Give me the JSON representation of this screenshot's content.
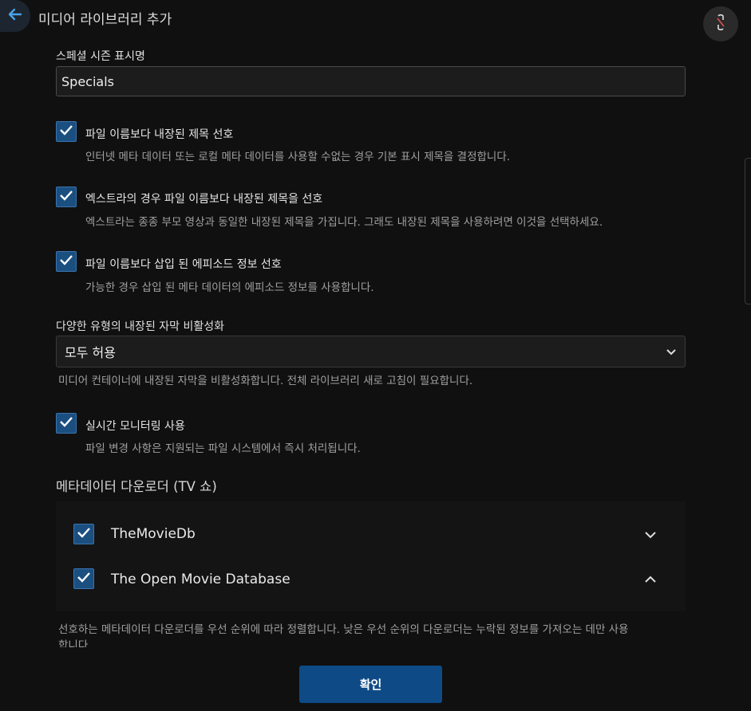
{
  "header": {
    "title": "미디어 라이브러리 추가"
  },
  "special_season": {
    "label": "스페셜 시즌 표시명",
    "value": "Specials"
  },
  "options": [
    {
      "label": "파일 이름보다 내장된 제목 선호",
      "description": "인터넷 메타 데이터 또는 로컬 메타 데이터를 사용할 수없는 경우 기본 표시 제목을 결정합니다.",
      "checked": true
    },
    {
      "label": "엑스트라의 경우 파일 이름보다 내장된 제목을 선호",
      "description": "엑스트라는 종종 부모 영상과 동일한 내장된 제목을 가집니다. 그래도 내장된 제목을 사용하려면 이것을 선택하세요.",
      "checked": true
    },
    {
      "label": "파일 이름보다 삽입 된 에피소드 정보 선호",
      "description": "가능한 경우 삽입 된 메타 데이터의 에피소드 정보를 사용합니다.",
      "checked": true
    }
  ],
  "subtitles": {
    "label": "다양한 유형의 내장된 자막 비활성화",
    "selected": "모두 허용",
    "description": "미디어 컨테이너에 내장된 자막을 비활성화합니다. 전체 라이브러리 새로 고침이 필요합니다."
  },
  "realtime": {
    "label": "실시간 모니터링 사용",
    "description": "파일 변경 사항은 지원되는 파일 시스템에서 즉시 처리됩니다.",
    "checked": true
  },
  "metadata_downloaders": {
    "title": "메타데이터 다운로더 (TV 쇼)",
    "items": [
      {
        "name": "TheMovieDb",
        "checked": true
      },
      {
        "name": "The Open Movie Database",
        "checked": true
      }
    ],
    "description_line1": "선호하는 메타데이터 다운로더를 우선 순위에 따라 정렬합니다. 낮은 우선 순위의 다운로더는 누락된 정보를 가져오는 데만 사용",
    "description_line2": "합니다."
  },
  "confirm_label": "확인",
  "colors": {
    "background": "#101010",
    "checkbox": "#1b4f80",
    "primary_button": "#0e4a86",
    "accent_arrow": "#4aa3e8"
  }
}
